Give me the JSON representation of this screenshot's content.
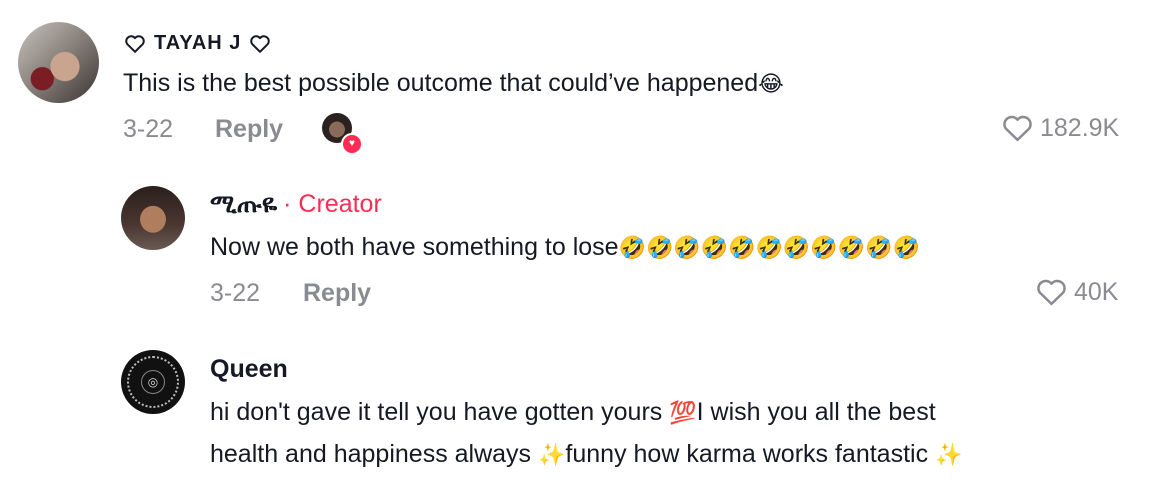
{
  "comments": [
    {
      "author": "TAYAH J",
      "text": "This is the best possible outcome that could’ve happened",
      "emoji": "😂",
      "date": "3-22",
      "reply_label": "Reply",
      "likes": "182.9K",
      "creator_liked": true
    },
    {
      "author": "ሚጡዬ",
      "creator_label": "· Creator",
      "text": "Now we both have something to lose",
      "emoji": "🤣🤣🤣🤣🤣🤣🤣🤣🤣🤣🤣",
      "date": "3-22",
      "reply_label": "Reply",
      "likes": "40K"
    },
    {
      "author": "Queen",
      "text_line1": "hi don't gave it tell you have gotten yours ",
      "emoji1": "💯",
      "text_line1b": "I wish you all the best",
      "text_line2": "health and happiness always ",
      "emoji2": "✨",
      "text_line2b": "funny how karma works fantastic ",
      "emoji3": "✨"
    }
  ],
  "colors": {
    "creator": "#fe2c55",
    "meta": "#8a8b91",
    "text": "#161823"
  },
  "icons": {
    "heart": "heart-outline-icon"
  }
}
